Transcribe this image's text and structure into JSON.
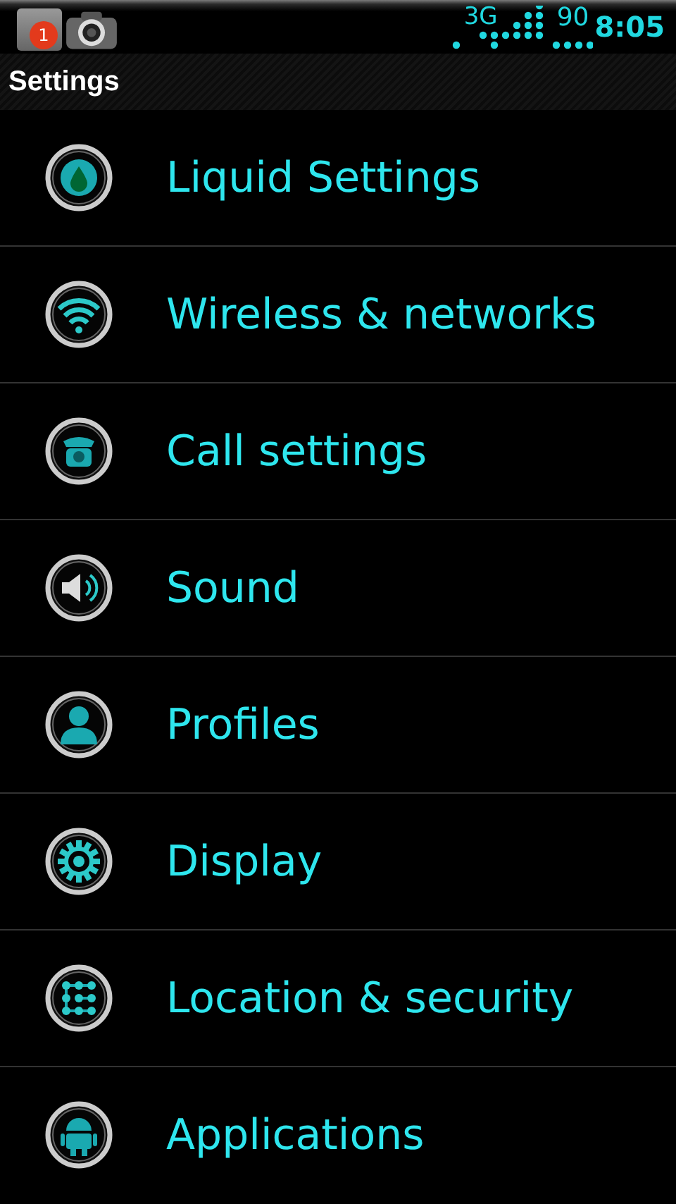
{
  "status_bar": {
    "notification_badge": "1",
    "network": "3G",
    "battery": "90",
    "time": "8:05"
  },
  "title": "Settings",
  "items": [
    {
      "label": "Liquid Settings",
      "kind": "drop"
    },
    {
      "label": "Wireless & networks",
      "kind": "wifi"
    },
    {
      "label": "Call settings",
      "kind": "phone"
    },
    {
      "label": "Sound",
      "kind": "speaker"
    },
    {
      "label": "Profiles",
      "kind": "person"
    },
    {
      "label": "Display",
      "kind": "gear"
    },
    {
      "label": "Location & security",
      "kind": "pattern"
    },
    {
      "label": "Applications",
      "kind": "robot"
    }
  ]
}
